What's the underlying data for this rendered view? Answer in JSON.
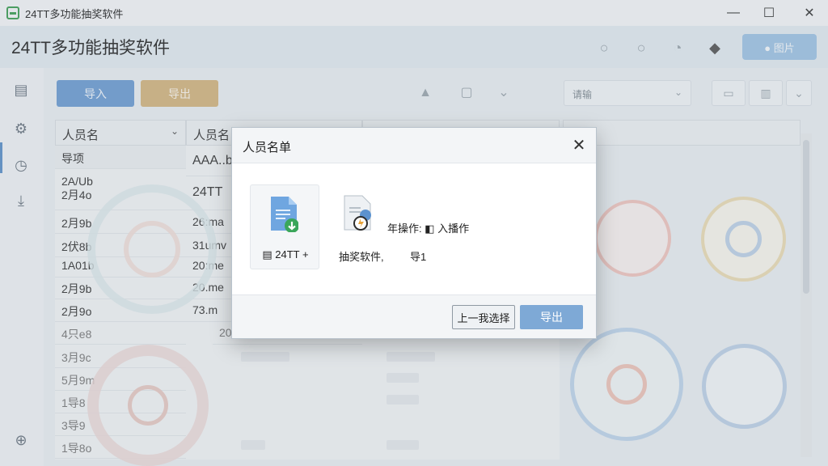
{
  "window": {
    "title": "24TT多功能抽奖软件",
    "minimize": "—",
    "maximize": "☐",
    "close": "✕"
  },
  "header": {
    "app_title": "24TT多功能抽奖软件",
    "action_button": "● 图片"
  },
  "toolbar": {
    "import_label": "导入",
    "export_label": "导出",
    "filter_value": "请输",
    "filter_chevron": "⌄"
  },
  "table": {
    "columns": [
      {
        "label": "人员名",
        "chevron": "⌄"
      },
      {
        "label": "人员名",
        "chevron": ""
      }
    ],
    "rows": [
      {
        "c1": "导项",
        "c2": "AAA..b"
      },
      {
        "c1": "2A/Ub\n2月4o",
        "c2": "24TT"
      },
      {
        "c1": "2月9b",
        "c2": "26:ma"
      },
      {
        "c1": "2伏8b",
        "c2": "31umv"
      },
      {
        "c1": "1A01b",
        "c2": "20:me"
      },
      {
        "c1": "2月9b",
        "c2": "20.me"
      },
      {
        "c1": "2月9o",
        "c2": "73.m"
      },
      {
        "c1": "4只e8",
        "c2": "20"
      },
      {
        "c1": "3月9c",
        "c2": ""
      },
      {
        "c1": "5月9m",
        "c2": ""
      },
      {
        "c1": "1导8",
        "c2": ""
      },
      {
        "c1": "3导9",
        "c2": ""
      },
      {
        "c1": "1导8o",
        "c2": ""
      }
    ]
  },
  "dialog": {
    "title": "人员名单",
    "close": "✕",
    "tile_label": "▤ 24TT +",
    "text_line1": "年操作: ◧ 入播作",
    "text_line2a": "抽奖软件,",
    "text_line2b": "导1",
    "cancel_label": "上一我选择",
    "ok_label": "导出"
  },
  "colors": {
    "accent": "#7ea9d6",
    "import": "#6c9bd1",
    "export": "#d2b47e"
  }
}
